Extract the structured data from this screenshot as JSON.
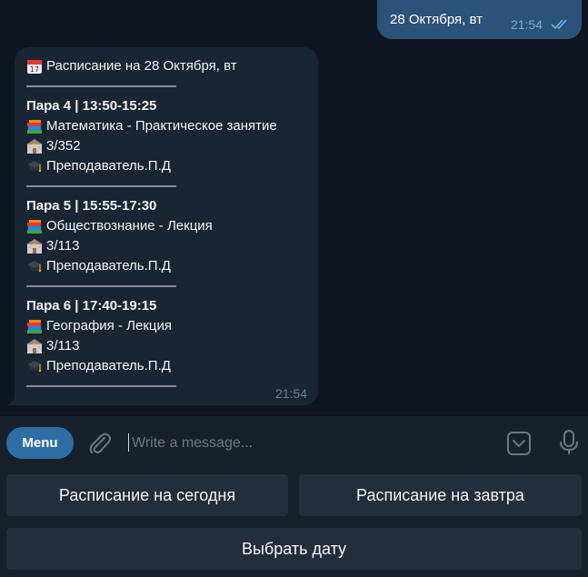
{
  "chat": {
    "outgoing": {
      "text": "28 Октября, вт",
      "time": "21:54",
      "status_icon": "double-check-icon"
    },
    "incoming": {
      "time": "21:54",
      "lines": [
        {
          "icon": "calendar-icon",
          "text": "Расписание на 28 Октября, вт",
          "bold": false
        },
        {
          "icon": "",
          "text": "———————————",
          "bold": false
        },
        {
          "icon": "",
          "text": "Пара 4 | 13:50-15:25",
          "bold": true
        },
        {
          "icon": "books-icon",
          "text": "Математика - Практическое занятие",
          "bold": false
        },
        {
          "icon": "school-building-icon",
          "text": "3/352",
          "bold": false
        },
        {
          "icon": "graduation-cap-icon",
          "text": "Преподаватель.П.Д",
          "bold": false
        },
        {
          "icon": "",
          "text": "———————————",
          "bold": false
        },
        {
          "icon": "",
          "text": "Пара 5 | 15:55-17:30",
          "bold": true
        },
        {
          "icon": "books-icon",
          "text": "Обществознание - Лекция",
          "bold": false
        },
        {
          "icon": "school-building-icon",
          "text": "3/113",
          "bold": false
        },
        {
          "icon": "graduation-cap-icon",
          "text": "Преподаватель.П.Д",
          "bold": false
        },
        {
          "icon": "",
          "text": "———————————",
          "bold": false
        },
        {
          "icon": "",
          "text": "Пара 6 | 17:40-19:15",
          "bold": true
        },
        {
          "icon": "books-icon",
          "text": "География - Лекция",
          "bold": false
        },
        {
          "icon": "school-building-icon",
          "text": "3/113",
          "bold": false
        },
        {
          "icon": "graduation-cap-icon",
          "text": "Преподаватель.П.Д",
          "bold": false
        },
        {
          "icon": "",
          "text": "———————————",
          "bold": false
        }
      ]
    }
  },
  "input_bar": {
    "menu_label": "Menu",
    "placeholder": "Write a message...",
    "attach_icon": "paperclip-icon",
    "emoji_icon": "sticker-emoji-icon",
    "mic_icon": "microphone-icon"
  },
  "keyboard": {
    "today_label": "Расписание на сегодня",
    "tomorrow_label": "Расписание на завтра",
    "pick_date_label": "Выбрать дату"
  },
  "colors": {
    "background": "#0e1621",
    "outgoing_bubble": "#2b5278",
    "incoming_bubble": "#182533",
    "panel": "#17212b",
    "menu_button": "#2f6ea5",
    "keyboard_button": "#232e3c"
  }
}
